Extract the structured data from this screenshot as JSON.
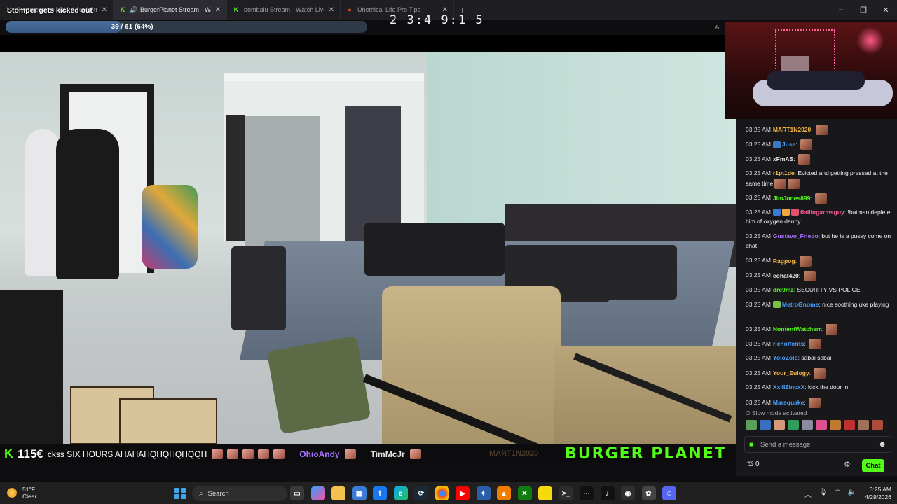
{
  "browser": {
    "tabs": [
      {
        "title": "Stomper gets kicked out | Streams on K",
        "favicon": "kick-icon",
        "active": false
      },
      {
        "title": "BurgerPlanet Stream - Watch Live on Kick",
        "favicon": "kick-icon",
        "active": true,
        "audio": true
      },
      {
        "title": "bombaiu Stream - Watch Live on Kick",
        "favicon": "kick-icon",
        "active": false
      },
      {
        "title": "Unethical Life Pro Tips",
        "favicon": "reddit-icon",
        "active": false
      }
    ],
    "new_tab": "+",
    "window_controls": [
      "–",
      "❐",
      "✕"
    ]
  },
  "overlay": {
    "title": "Stomper gets kicked out",
    "goal_text": "39 / 61 (64%)",
    "goal_fraction": 0.64,
    "timer": "2 3:4 9:1 5"
  },
  "ticker": {
    "logo": "K",
    "count": "115€",
    "items": [
      {
        "type": "msg",
        "text": "ckss SIX HOURS AHAHAHQHQHQHQQH"
      },
      {
        "type": "user",
        "text": "OhioAndy",
        "color": "#a970ff"
      },
      {
        "type": "user",
        "text": "TimMcJr",
        "color": "#e6e6e6"
      }
    ],
    "faded_user": "MART1N2020",
    "brand": "BURGER PLANET"
  },
  "chat": {
    "messages": [
      {
        "time": "03:25 AM",
        "user": "MART1N2020",
        "user_color": "#f5b642",
        "text": "",
        "emotes": 1
      },
      {
        "time": "03:25 AM",
        "user": "Juse",
        "user_color": "#4aa0ff",
        "text": "",
        "emotes": 1,
        "badges": [
          "#3b78c2"
        ]
      },
      {
        "time": "03:25 AM",
        "user": "xFmAS",
        "user_color": "#e6e6e6",
        "text": "",
        "emotes": 1
      },
      {
        "time": "03:25 AM",
        "user": "r1pt1de",
        "user_color": "#f5c542",
        "text": "Evicted and getting pressed at the same time",
        "emotes": 2
      },
      {
        "time": "03:25 AM",
        "user": "JimJones899",
        "user_color": "#53fc18",
        "text": "",
        "emotes": 1
      },
      {
        "time": "03:25 AM",
        "user": "flailingarmsguy",
        "user_color": "#ff5fa0",
        "text": "!batman deplete him of oxygen danny",
        "emotes": 0,
        "badges": [
          "#3a7bd5",
          "#f0a83a",
          "#e05070"
        ]
      },
      {
        "time": "03:25 AM",
        "user": "Gustavo_Friedo",
        "user_color": "#a970ff",
        "text": "but he is a pussy come on chat",
        "emotes": 0
      },
      {
        "time": "03:25 AM",
        "user": "Ragpog",
        "user_color": "#f5b642",
        "text": "",
        "emotes": 1
      },
      {
        "time": "03:25 AM",
        "user": "eohat420",
        "user_color": "#e6e6e6",
        "text": "",
        "emotes": 1
      },
      {
        "time": "03:25 AM",
        "user": "dre9mz",
        "user_color": "#53fc18",
        "text": "SECURITY VS POLICE",
        "emotes": 0
      },
      {
        "time": "03:25 AM",
        "user": "MetroGnome",
        "user_color": "#4aa0ff",
        "text": "nice soothing uke playing",
        "emotes": 0,
        "badges": [
          "#7ac142"
        ]
      },
      {
        "time": "03:25 AM",
        "user": "NontentWatcherr",
        "user_color": "#53fc18",
        "text": "",
        "emotes": 1
      },
      {
        "time": "03:25 AM",
        "user": "richoffcrits",
        "user_color": "#4aa0ff",
        "text": "",
        "emotes": 1
      },
      {
        "time": "03:25 AM",
        "user": "YoloZolo",
        "user_color": "#4aa0ff",
        "text": "sabai sabai",
        "emotes": 0
      },
      {
        "time": "03:25 AM",
        "user": "Your_Eulogy",
        "user_color": "#f5b642",
        "text": "",
        "emotes": 1
      },
      {
        "time": "03:25 AM",
        "user": "XxIlIZincxX",
        "user_color": "#4aa0ff",
        "text": "kick the door in",
        "emotes": 0
      },
      {
        "time": "03:25 AM",
        "user": "Marsquake",
        "user_color": "#4aa0ff",
        "text": "",
        "emotes": 1
      }
    ],
    "slow_mode": "Slow mode activated",
    "input_placeholder": "Send a message",
    "points": "0",
    "send_label": "Chat",
    "accent": "#53fc18"
  },
  "taskbar": {
    "weather_temp": "51°F",
    "weather_desc": "Clear",
    "search_label": "Search",
    "time": "3:25 AM",
    "date": "4/29/2026"
  }
}
